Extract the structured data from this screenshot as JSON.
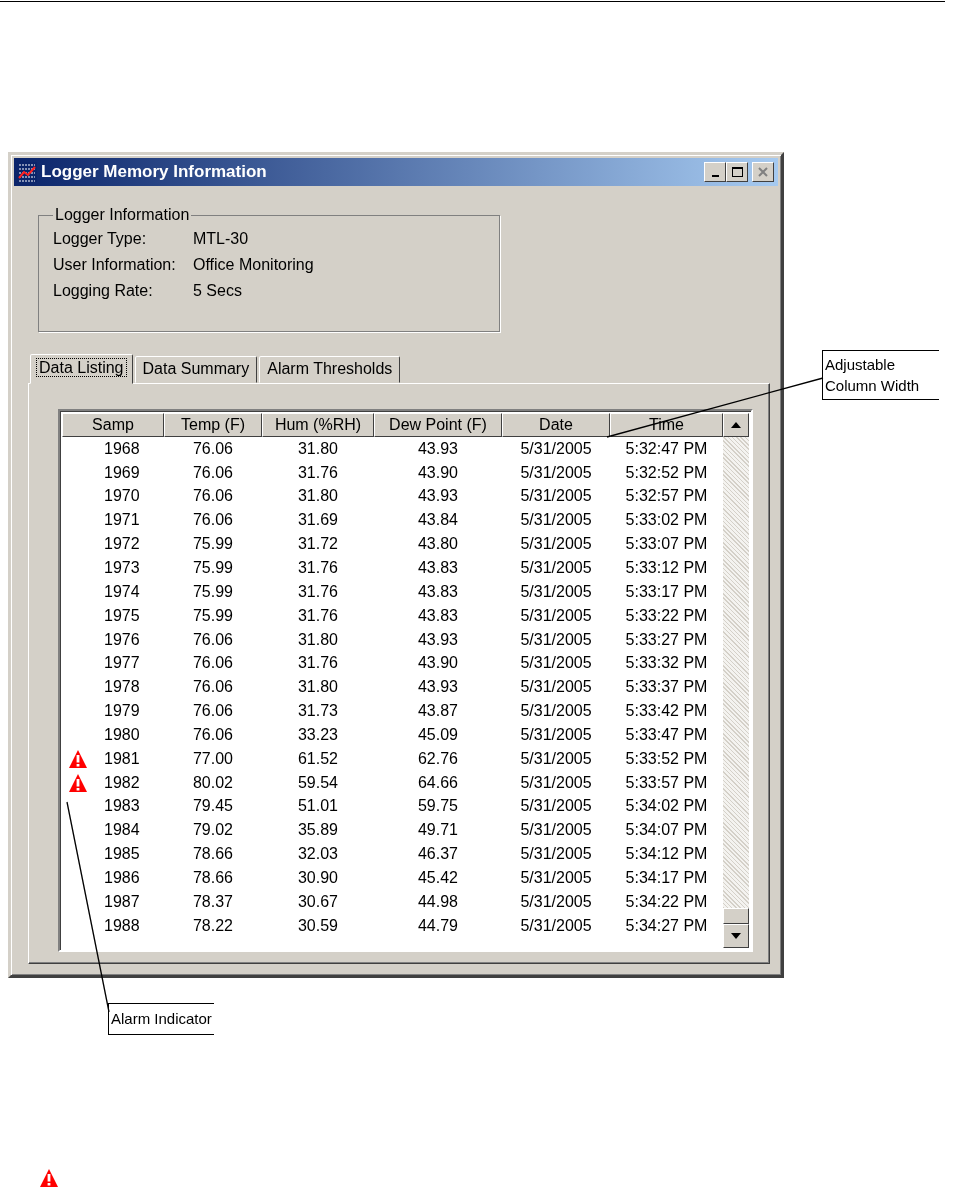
{
  "window": {
    "title": "Logger Memory Information"
  },
  "logger_information": {
    "title": "Logger Information",
    "fields": [
      {
        "label": "Logger Type:",
        "value": "MTL-30"
      },
      {
        "label": "User Information:",
        "value": "Office Monitoring"
      },
      {
        "label": "Logging Rate:",
        "value": "5 Secs"
      }
    ]
  },
  "tabs": [
    {
      "label": "Data Listing",
      "selected": true
    },
    {
      "label": "Data Summary",
      "selected": false
    },
    {
      "label": "Alarm Thresholds",
      "selected": false
    }
  ],
  "table": {
    "columns": [
      "Samp",
      "Temp (F)",
      "Hum (%RH)",
      "Dew Point (F)",
      "Date",
      "Time"
    ],
    "rows": [
      {
        "alarm": false,
        "cells": [
          "1968",
          "76.06",
          "31.80",
          "43.93",
          "5/31/2005",
          "5:32:47 PM"
        ]
      },
      {
        "alarm": false,
        "cells": [
          "1969",
          "76.06",
          "31.76",
          "43.90",
          "5/31/2005",
          "5:32:52 PM"
        ]
      },
      {
        "alarm": false,
        "cells": [
          "1970",
          "76.06",
          "31.80",
          "43.93",
          "5/31/2005",
          "5:32:57 PM"
        ]
      },
      {
        "alarm": false,
        "cells": [
          "1971",
          "76.06",
          "31.69",
          "43.84",
          "5/31/2005",
          "5:33:02 PM"
        ]
      },
      {
        "alarm": false,
        "cells": [
          "1972",
          "75.99",
          "31.72",
          "43.80",
          "5/31/2005",
          "5:33:07 PM"
        ]
      },
      {
        "alarm": false,
        "cells": [
          "1973",
          "75.99",
          "31.76",
          "43.83",
          "5/31/2005",
          "5:33:12 PM"
        ]
      },
      {
        "alarm": false,
        "cells": [
          "1974",
          "75.99",
          "31.76",
          "43.83",
          "5/31/2005",
          "5:33:17 PM"
        ]
      },
      {
        "alarm": false,
        "cells": [
          "1975",
          "75.99",
          "31.76",
          "43.83",
          "5/31/2005",
          "5:33:22 PM"
        ]
      },
      {
        "alarm": false,
        "cells": [
          "1976",
          "76.06",
          "31.80",
          "43.93",
          "5/31/2005",
          "5:33:27 PM"
        ]
      },
      {
        "alarm": false,
        "cells": [
          "1977",
          "76.06",
          "31.76",
          "43.90",
          "5/31/2005",
          "5:33:32 PM"
        ]
      },
      {
        "alarm": false,
        "cells": [
          "1978",
          "76.06",
          "31.80",
          "43.93",
          "5/31/2005",
          "5:33:37 PM"
        ]
      },
      {
        "alarm": false,
        "cells": [
          "1979",
          "76.06",
          "31.73",
          "43.87",
          "5/31/2005",
          "5:33:42 PM"
        ]
      },
      {
        "alarm": false,
        "cells": [
          "1980",
          "76.06",
          "33.23",
          "45.09",
          "5/31/2005",
          "5:33:47 PM"
        ]
      },
      {
        "alarm": true,
        "cells": [
          "1981",
          "77.00",
          "61.52",
          "62.76",
          "5/31/2005",
          "5:33:52 PM"
        ]
      },
      {
        "alarm": true,
        "cells": [
          "1982",
          "80.02",
          "59.54",
          "64.66",
          "5/31/2005",
          "5:33:57 PM"
        ]
      },
      {
        "alarm": false,
        "cells": [
          "1983",
          "79.45",
          "51.01",
          "59.75",
          "5/31/2005",
          "5:34:02 PM"
        ]
      },
      {
        "alarm": false,
        "cells": [
          "1984",
          "79.02",
          "35.89",
          "49.71",
          "5/31/2005",
          "5:34:07 PM"
        ]
      },
      {
        "alarm": false,
        "cells": [
          "1985",
          "78.66",
          "32.03",
          "46.37",
          "5/31/2005",
          "5:34:12 PM"
        ]
      },
      {
        "alarm": false,
        "cells": [
          "1986",
          "78.66",
          "30.90",
          "45.42",
          "5/31/2005",
          "5:34:17 PM"
        ]
      },
      {
        "alarm": false,
        "cells": [
          "1987",
          "78.37",
          "30.67",
          "44.98",
          "5/31/2005",
          "5:34:22 PM"
        ]
      },
      {
        "alarm": false,
        "cells": [
          "1988",
          "78.22",
          "30.59",
          "44.79",
          "5/31/2005",
          "5:34:27 PM"
        ]
      }
    ]
  },
  "callouts": [
    {
      "kind": "column",
      "text": "Adjustable Column Width"
    },
    {
      "kind": "alarm",
      "text": "Alarm Indicator"
    }
  ]
}
